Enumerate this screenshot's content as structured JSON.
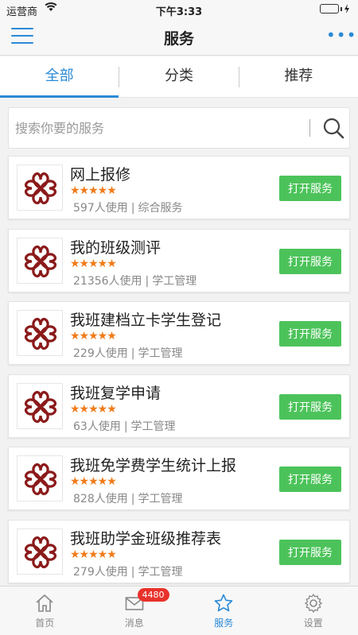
{
  "status_bar": {
    "carrier": "运营商",
    "time": "下午3:33"
  },
  "header": {
    "title": "服务"
  },
  "tabs": [
    {
      "label": "全部",
      "active": true
    },
    {
      "label": "分类",
      "active": false
    },
    {
      "label": "推荐",
      "active": false
    }
  ],
  "search": {
    "placeholder": "搜索你要的服务"
  },
  "services": [
    {
      "name": "网上报修",
      "rating_stars": "★★★★★",
      "usage": "597人使用",
      "category": "综合服务",
      "button": "打开服务"
    },
    {
      "name": "我的班级测评",
      "rating_stars": "★★★★★",
      "usage": "21356人使用",
      "category": "学工管理",
      "button": "打开服务"
    },
    {
      "name": "我班建档立卡学生登记",
      "rating_stars": "★★★★★",
      "usage": "229人使用",
      "category": "学工管理",
      "button": "打开服务"
    },
    {
      "name": "我班复学申请",
      "rating_stars": "★★★★★",
      "usage": "63人使用",
      "category": "学工管理",
      "button": "打开服务"
    },
    {
      "name": "我班免学费学生统计上报",
      "rating_stars": "★★★★★",
      "usage": "828人使用",
      "category": "学工管理",
      "button": "打开服务"
    },
    {
      "name": "我班助学金班级推荐表",
      "rating_stars": "★★★★★",
      "usage": "279人使用",
      "category": "学工管理",
      "button": "打开服务"
    }
  ],
  "bottom_tabs": [
    {
      "label": "首页",
      "icon": "home-icon"
    },
    {
      "label": "消息",
      "icon": "mail-icon",
      "badge": "4480"
    },
    {
      "label": "服务",
      "icon": "star-icon",
      "active": true
    },
    {
      "label": "设置",
      "icon": "gear-icon"
    }
  ],
  "colors": {
    "accent": "#2a8ad6",
    "button_green": "#4cc35a",
    "star_orange": "#f07b1a",
    "badge_red": "#e8322b",
    "logo_red": "#8b1a1a"
  }
}
